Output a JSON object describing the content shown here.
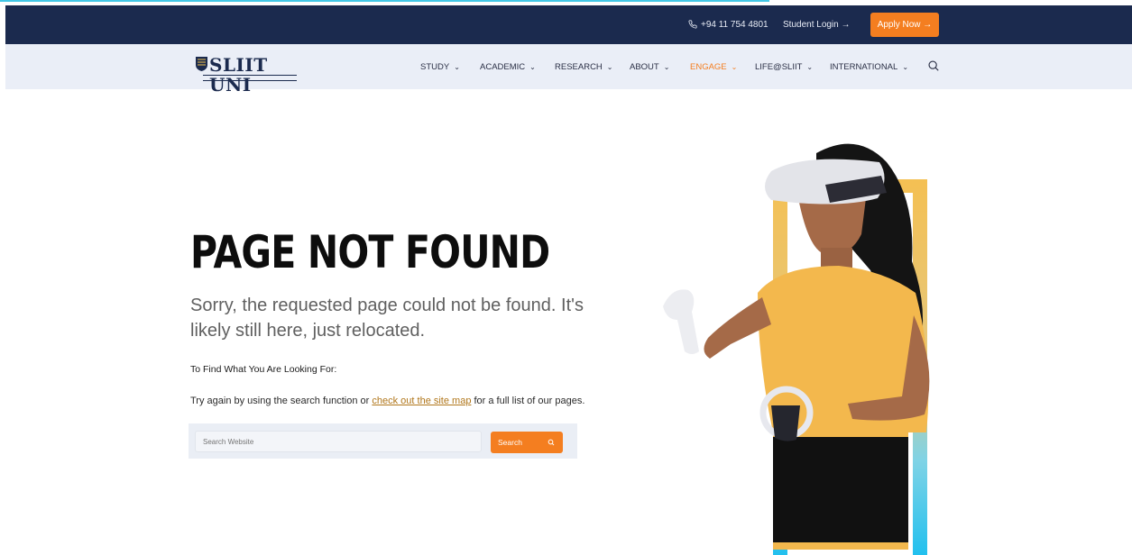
{
  "topbar": {
    "phone": "+94 11 754 4801",
    "student_login": "Student Login →",
    "apply_now": "Apply Now →"
  },
  "logo": {
    "text": "SLIIT UNI"
  },
  "nav": {
    "items": [
      {
        "label": "STUDY"
      },
      {
        "label": "ACADEMIC"
      },
      {
        "label": "RESEARCH"
      },
      {
        "label": "ABOUT"
      },
      {
        "label": "ENGAGE"
      },
      {
        "label": "LIFE@SLIIT"
      },
      {
        "label": "INTERNATIONAL"
      }
    ],
    "active": "ENGAGE"
  },
  "main": {
    "title": "PAGE NOT FOUND",
    "lead": "Sorry, the requested page could not be found. It's likely still here, just relocated.",
    "find_label": "To Find What You Are Looking For:",
    "help_before": "Try again by using the search function or ",
    "help_link": "check out the site map",
    "help_after": " for a full list of our pages.",
    "search_placeholder": "Search Website",
    "search_button": "Search"
  },
  "colors": {
    "navy": "#1b2a4e",
    "orange": "#f47e20",
    "nav_bg": "#eaeef7"
  },
  "icons": [
    "phone-icon",
    "chevron-down-icon",
    "search-icon"
  ]
}
